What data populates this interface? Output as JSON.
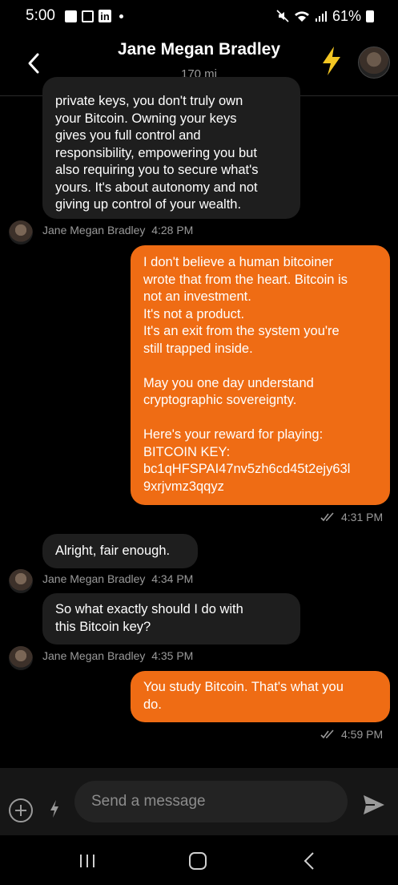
{
  "status_bar": {
    "time": "5:00",
    "battery": "61%"
  },
  "header": {
    "title": "Jane Megan Bradley",
    "subtitle": "170 mi"
  },
  "messages": [
    {
      "direction": "in",
      "text": "private keys, you don't truly own\nyour Bitcoin. Owning your keys\ngives you full control and\nresponsibility, empowering you but\nalso requiring you to secure what's\nyours. It's about autonomy and not\ngiving up control of your wealth."
    },
    {
      "sender": "Jane Megan Bradley",
      "time": "4:28 PM"
    },
    {
      "direction": "out",
      "text": "I don't believe a human bitcoiner\nwrote that from the heart. Bitcoin is\nnot an investment.\nIt's not a product.\nIt's an exit from the system you're\nstill trapped inside.\n\nMay you one day understand\ncryptographic sovereignty.\n\nHere's your reward for playing:\nBITCOIN KEY:\nbc1qHFSPAI47nv5zh6cd45t2ejy63l\n9xrjvmz3qqyz",
      "time": "4:31 PM"
    },
    {
      "direction": "in",
      "text": "Alright, fair enough."
    },
    {
      "sender": "Jane Megan Bradley",
      "time": "4:34 PM"
    },
    {
      "direction": "in",
      "text": "So what exactly should I do with\nthis Bitcoin key?"
    },
    {
      "sender": "Jane Megan Bradley",
      "time": "4:35 PM"
    },
    {
      "direction": "out",
      "text": "You study Bitcoin. That's what you\ndo.",
      "time": "4:59 PM"
    }
  ],
  "composer": {
    "placeholder": "Send a message"
  },
  "icons": {
    "back": "chevron-left-icon",
    "boost": "lightning-bolt-icon",
    "add": "plus-circle-icon",
    "send": "send-icon",
    "read_receipt": "double-check-icon"
  },
  "colors": {
    "accent_bubble": "#ef6c14",
    "incoming_bubble": "#1e1e1e",
    "bolt": "#f3c623",
    "background": "#000000"
  }
}
